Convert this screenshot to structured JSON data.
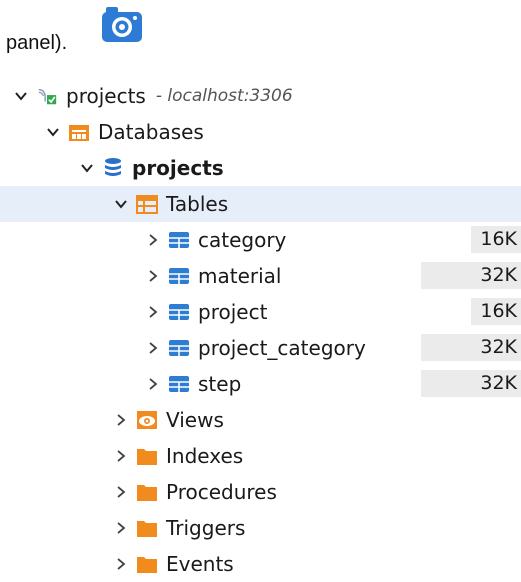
{
  "caption": "panel).",
  "connection": {
    "label": "projects",
    "host": "- localhost:3306"
  },
  "databases_label": "Databases",
  "database": {
    "label": "projects"
  },
  "tables_label": "Tables",
  "tables": [
    {
      "name": "category",
      "size": "16K"
    },
    {
      "name": "material",
      "size": "32K"
    },
    {
      "name": "project",
      "size": "16K"
    },
    {
      "name": "project_category",
      "size": "32K"
    },
    {
      "name": "step",
      "size": "32K"
    }
  ],
  "folders": [
    "Views",
    "Indexes",
    "Procedures",
    "Triggers",
    "Events"
  ],
  "colors": {
    "selection": "#e6eff9",
    "folder_orange": "#f28b1e",
    "table_blue": "#2d7dd2",
    "db_blue": "#2a6fc9",
    "size_bar": "#ebebeb"
  }
}
